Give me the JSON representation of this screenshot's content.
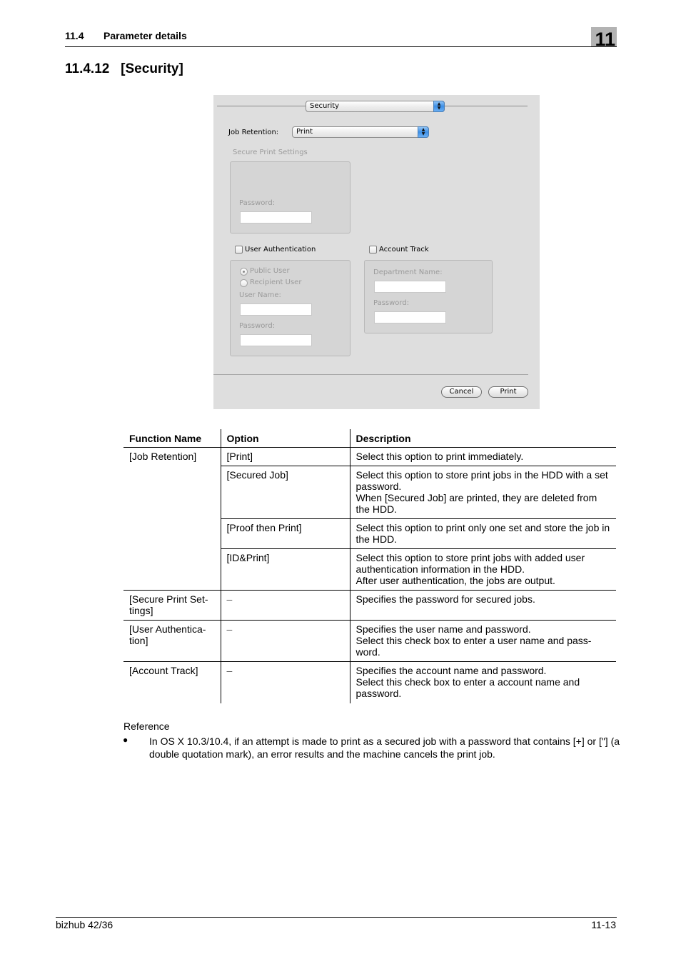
{
  "header": {
    "section_number": "11.4",
    "section_title": "Parameter details",
    "chapter": "11"
  },
  "section_heading": "11.4.12   [Security]",
  "dialog": {
    "panel_popup": "Security",
    "job_retention_label": "Job Retention:",
    "job_retention_value": "Print",
    "secure_print_group_label": "Secure Print Settings",
    "secure_print_password_label": "Password:",
    "secure_print_password_value": "",
    "user_auth_checkbox_label": "User Authentication",
    "user_auth_checked": false,
    "public_user_label": "Public User",
    "recipient_user_label": "Recipient User",
    "selected_user_type": "Public User",
    "user_name_label": "User Name:",
    "user_name_value": "",
    "user_password_label": "Password:",
    "user_password_value": "",
    "account_track_checkbox_label": "Account Track",
    "account_track_checked": false,
    "department_name_label": "Department Name:",
    "department_name_value": "",
    "account_password_label": "Password:",
    "account_password_value": "",
    "cancel_button": "Cancel",
    "print_button": "Print"
  },
  "table": {
    "headers": [
      "Function Name",
      "Option",
      "Description"
    ],
    "rows": [
      {
        "function": "[Job Retention]",
        "option": "[Print]",
        "description": "Select this option to print immediately."
      },
      {
        "function": "",
        "option": "[Secured Job]",
        "description": "Select this option to store print jobs in the HDD with a set password.\nWhen [Secured Job] are printed, they are deleted from the HDD."
      },
      {
        "function": "",
        "option": "[Proof then Print]",
        "description": "Select this option to print only one set and store the job in the HDD."
      },
      {
        "function": "",
        "option": "[ID&Print]",
        "description": "Select this option to store print jobs with added user authentication information in the HDD.\nAfter user authentication, the jobs are output."
      },
      {
        "function": "[Secure Print Set-\ntings]",
        "option": "–",
        "description": "Specifies the password for secured jobs."
      },
      {
        "function": "[User Authentica-\ntion]",
        "option": "–",
        "description": "Specifies the user name and password.\nSelect this check box to enter a user name and pass-\nword."
      },
      {
        "function": "[Account Track]",
        "option": "–",
        "description": "Specifies the account name and password.\nSelect this check box to enter a account name and password."
      }
    ]
  },
  "reference": {
    "title": "Reference",
    "bullet": "●",
    "items": [
      "In OS X 10.3/10.4, if an attempt is made to print as a secured job with a password that contains [+] or [\"] (a double quotation mark), an error results and the machine cancels the print job."
    ]
  },
  "footer": {
    "product": "bizhub 42/36",
    "page": "11-13"
  }
}
